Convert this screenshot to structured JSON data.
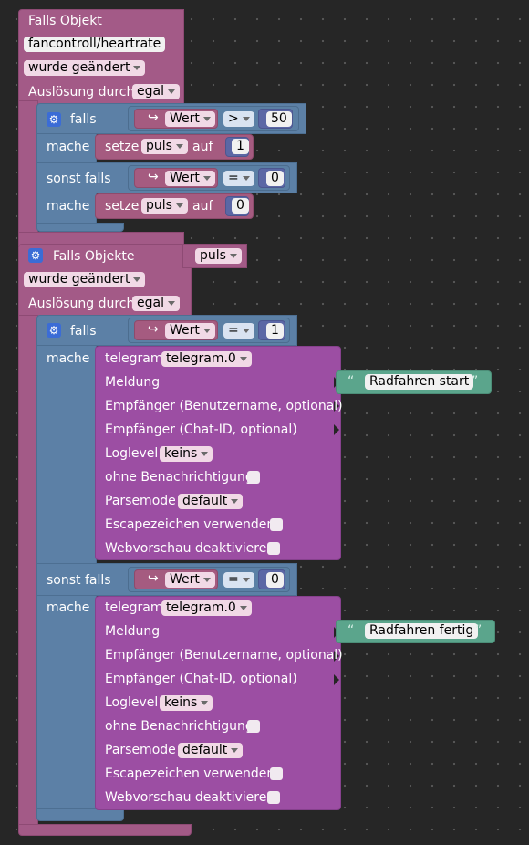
{
  "block1": {
    "title": "Falls Objekt",
    "object_id": "fancontroll/heartrate",
    "change_mode": "wurde geändert",
    "trigger_label": "Auslösung durch",
    "trigger_value": "egal",
    "if_label": "falls",
    "do_label": "mache",
    "elseif_label": "sonst falls",
    "cond1": {
      "var": "Wert",
      "op": ">",
      "value": "50"
    },
    "set1": {
      "set_label": "setze",
      "var": "puls",
      "to_label": "auf",
      "value": "1"
    },
    "cond2": {
      "var": "Wert",
      "op": "=",
      "value": "0"
    },
    "set2": {
      "set_label": "setze",
      "var": "puls",
      "to_label": "auf",
      "value": "0"
    }
  },
  "block2": {
    "title": "Falls Objekte",
    "object_var": "puls",
    "change_mode": "wurde geändert",
    "trigger_label": "Auslösung durch",
    "trigger_value": "egal",
    "if_label": "falls",
    "do_label": "mache",
    "elseif_label": "sonst falls",
    "cond1": {
      "var": "Wert",
      "op": "=",
      "value": "1"
    },
    "cond2": {
      "var": "Wert",
      "op": "=",
      "value": "0"
    },
    "telegram1": {
      "label": "telegram",
      "instance": "telegram.0",
      "message_label": "Meldung",
      "message": "Radfahren start",
      "recipient_user_label": "Empfänger (Benutzername, optional)",
      "recipient_chat_label": "Empfänger (Chat-ID, optional)",
      "loglevel_label": "Loglevel",
      "loglevel": "keins",
      "silent_label": "ohne Benachrichtigung",
      "parsemode_label": "Parsemode",
      "parsemode": "default",
      "escape_label": "Escapezeichen verwenden",
      "preview_label": "Webvorschau deaktivieren"
    },
    "telegram2": {
      "label": "telegram",
      "instance": "telegram.0",
      "message_label": "Meldung",
      "message": "Radfahren fertig",
      "recipient_user_label": "Empfänger (Benutzername, optional)",
      "recipient_chat_label": "Empfänger (Chat-ID, optional)",
      "loglevel_label": "Loglevel",
      "loglevel": "keins",
      "silent_label": "ohne Benachrichtigung",
      "parsemode_label": "Parsemode",
      "parsemode": "default",
      "escape_label": "Escapezeichen verwenden",
      "preview_label": "Webvorschau deaktivieren"
    }
  },
  "icons": {
    "gear": "gear-icon",
    "arrow": "return-arrow-icon"
  },
  "colors": {
    "trigger": "#a35a87",
    "control": "#5c80a6",
    "variable": "#a55b80",
    "logic": "#5b80a5",
    "math": "#5b67a5",
    "telegram": "#9c4ea3",
    "text": "#5ba58c",
    "background": "#262626"
  }
}
